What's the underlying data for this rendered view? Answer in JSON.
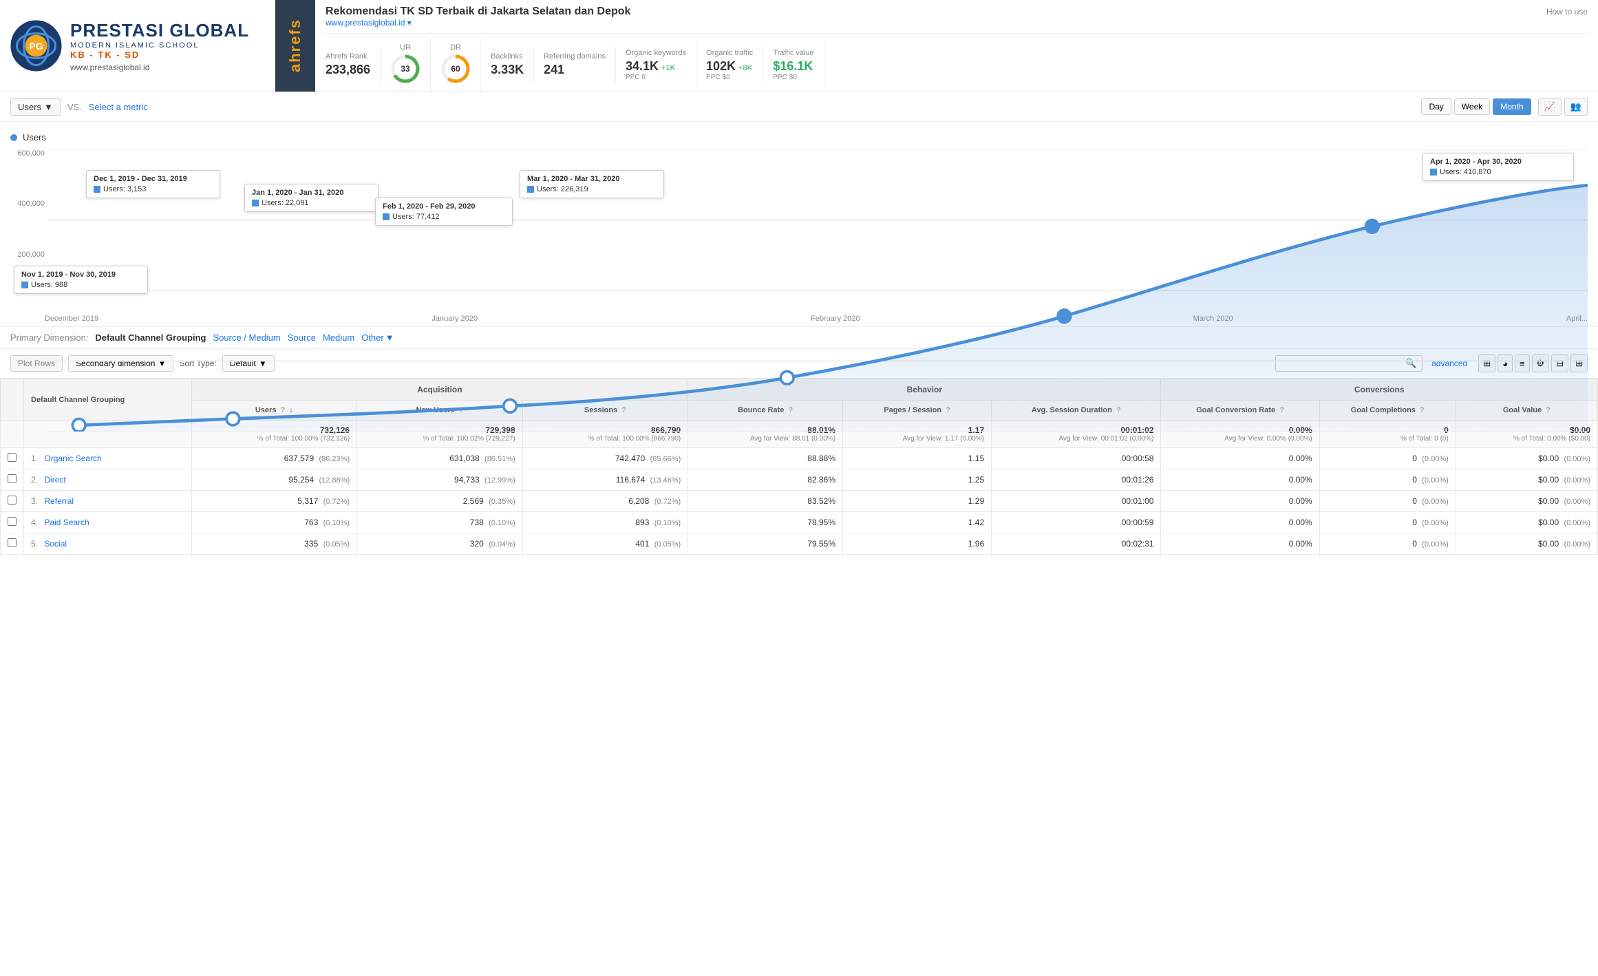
{
  "header": {
    "brand": "PRESTASI GLOBAL",
    "sub1": "MODERN ISLAMIC SCHOOL",
    "sub2": "KB - TK - SD",
    "url": "www.prestasiglobal.id",
    "site_title": "Rekomendasi TK SD Terbaik di Jakarta Selatan dan Depok",
    "site_url": "www.prestasiglobal.id ▾",
    "how_to_use": "How to use"
  },
  "metrics": {
    "ahrefs_rank_label": "Ahrefs Rank",
    "ahrefs_rank": "233,866",
    "ur_label": "UR",
    "ur_value": "33",
    "dr_label": "DR",
    "dr_value": "60",
    "backlinks_label": "Backlinks",
    "backlinks_value": "3.33K",
    "referring_label": "Referring domains",
    "referring_value": "241",
    "organic_kw_label": "Organic keywords",
    "organic_kw_value": "34.1K",
    "organic_kw_change": "+1K",
    "organic_kw_sub": "PPC 0",
    "organic_traffic_label": "Organic traffic",
    "organic_traffic_value": "102K",
    "organic_traffic_change": "+8K",
    "organic_traffic_sub": "PPC $0",
    "traffic_value_label": "Traffic value",
    "traffic_value_value": "$16.1K",
    "traffic_value_sub": "PPC $0"
  },
  "controls": {
    "metric_btn": "Users",
    "vs_label": "VS.",
    "select_metric": "Select a metric",
    "time_day": "Day",
    "time_week": "Week",
    "time_month": "Month"
  },
  "chart": {
    "legend_label": "Users",
    "y_labels": [
      "600,000",
      "400,000",
      "200,000",
      ""
    ],
    "x_labels": [
      "December 2019",
      "January 2020",
      "February 2020",
      "March 2020",
      "April..."
    ],
    "tooltips": [
      {
        "date": "Nov 1, 2019 - Nov 30, 2019",
        "value": "Users: 988",
        "x_pct": 2,
        "y_pct": 85
      },
      {
        "date": "Dec 1, 2019 - Dec 31, 2019",
        "value": "Users: 3,153",
        "x_pct": 12,
        "y_pct": 65
      },
      {
        "date": "Jan 1, 2020 - Jan 31, 2020",
        "value": "Users: 22,091",
        "x_pct": 30,
        "y_pct": 55
      },
      {
        "date": "Feb 1, 2020 - Feb 29, 2020",
        "value": "Users: 77,412",
        "x_pct": 48,
        "y_pct": 40
      },
      {
        "date": "Mar 1, 2020 - Mar 31, 2020",
        "value": "Users: 226,319",
        "x_pct": 66,
        "y_pct": 25
      },
      {
        "date": "Apr 1, 2020 - Apr 30, 2020",
        "value": "Users: 410,870",
        "x_pct": 86,
        "y_pct": 5
      }
    ]
  },
  "dimension": {
    "label": "Primary Dimension:",
    "active": "Default Channel Grouping",
    "links": [
      "Source / Medium",
      "Source",
      "Medium"
    ],
    "other": "Other"
  },
  "table_controls": {
    "plot_rows": "Plot Rows",
    "secondary_dim": "Secondary dimension",
    "sort_label": "Sort Type:",
    "sort_default": "Default",
    "search_placeholder": "",
    "advanced": "advanced"
  },
  "table": {
    "group_acquisition": "Acquisition",
    "group_behavior": "Behavior",
    "group_conversions": "Conversions",
    "col_dimension": "Default Channel Grouping",
    "col_users": "Users",
    "col_new_users": "New Users",
    "col_sessions": "Sessions",
    "col_bounce": "Bounce Rate",
    "col_pages": "Pages / Session",
    "col_avg_session": "Avg. Session Duration",
    "col_goal_conv": "Goal Conversion Rate",
    "col_goal_comp": "Goal Completions",
    "col_goal_val": "Goal Value",
    "total": {
      "users": "732,126",
      "users_sub": "% of Total: 100.00% (732,126)",
      "new_users": "729,398",
      "new_users_sub": "% of Total: 100.02% (729,227)",
      "sessions": "866,790",
      "sessions_sub": "% of Total: 100.00% (866,790)",
      "bounce": "88.01%",
      "bounce_sub": "Avg for View: 88.01 (0.00%)",
      "pages": "1.17",
      "pages_sub": "Avg for View: 1.17 (0.00%)",
      "avg_session": "00:01:02",
      "avg_session_sub": "Avg for View: 00:01:02 (0.00%)",
      "goal_conv": "0.00%",
      "goal_conv_sub": "Avg for View: 0.00% (0.00%)",
      "goal_comp": "0",
      "goal_comp_sub": "% of Total: 0 (0)",
      "goal_val": "$0.00",
      "goal_val_sub": "% of Total: 0.00% ($0.00)"
    },
    "rows": [
      {
        "num": "1.",
        "name": "Organic Search",
        "users": "637,579",
        "users_pct": "(86.23%)",
        "new_users": "631,038",
        "new_users_pct": "(86.51%)",
        "sessions": "742,470",
        "sessions_pct": "(85.66%)",
        "bounce": "88.88%",
        "pages": "1.15",
        "avg_session": "00:00:58",
        "goal_conv": "0.00%",
        "goal_comp": "0",
        "goal_comp_pct": "(0.00%)",
        "goal_val": "$0.00",
        "goal_val_pct": "(0.00%)"
      },
      {
        "num": "2.",
        "name": "Direct",
        "users": "95,254",
        "users_pct": "(12.88%)",
        "new_users": "94,733",
        "new_users_pct": "(12.99%)",
        "sessions": "116,674",
        "sessions_pct": "(13.46%)",
        "bounce": "82.86%",
        "pages": "1.25",
        "avg_session": "00:01:26",
        "goal_conv": "0.00%",
        "goal_comp": "0",
        "goal_comp_pct": "(0.00%)",
        "goal_val": "$0.00",
        "goal_val_pct": "(0.00%)"
      },
      {
        "num": "3.",
        "name": "Referral",
        "users": "5,317",
        "users_pct": "(0.72%)",
        "new_users": "2,569",
        "new_users_pct": "(0.35%)",
        "sessions": "6,208",
        "sessions_pct": "(0.72%)",
        "bounce": "83.52%",
        "pages": "1.29",
        "avg_session": "00:01:00",
        "goal_conv": "0.00%",
        "goal_comp": "0",
        "goal_comp_pct": "(0.00%)",
        "goal_val": "$0.00",
        "goal_val_pct": "(0.00%)"
      },
      {
        "num": "4.",
        "name": "Paid Search",
        "users": "763",
        "users_pct": "(0.10%)",
        "new_users": "738",
        "new_users_pct": "(0.10%)",
        "sessions": "893",
        "sessions_pct": "(0.10%)",
        "bounce": "78.95%",
        "pages": "1.42",
        "avg_session": "00:00:59",
        "goal_conv": "0.00%",
        "goal_comp": "0",
        "goal_comp_pct": "(0.00%)",
        "goal_val": "$0.00",
        "goal_val_pct": "(0.00%)"
      },
      {
        "num": "5.",
        "name": "Social",
        "users": "335",
        "users_pct": "(0.05%)",
        "new_users": "320",
        "new_users_pct": "(0.04%)",
        "sessions": "401",
        "sessions_pct": "(0.05%)",
        "bounce": "79.55%",
        "pages": "1.96",
        "avg_session": "00:02:31",
        "goal_conv": "0.00%",
        "goal_comp": "0",
        "goal_comp_pct": "(0.00%)",
        "goal_val": "$0.00",
        "goal_val_pct": "(0.00%)"
      }
    ]
  }
}
